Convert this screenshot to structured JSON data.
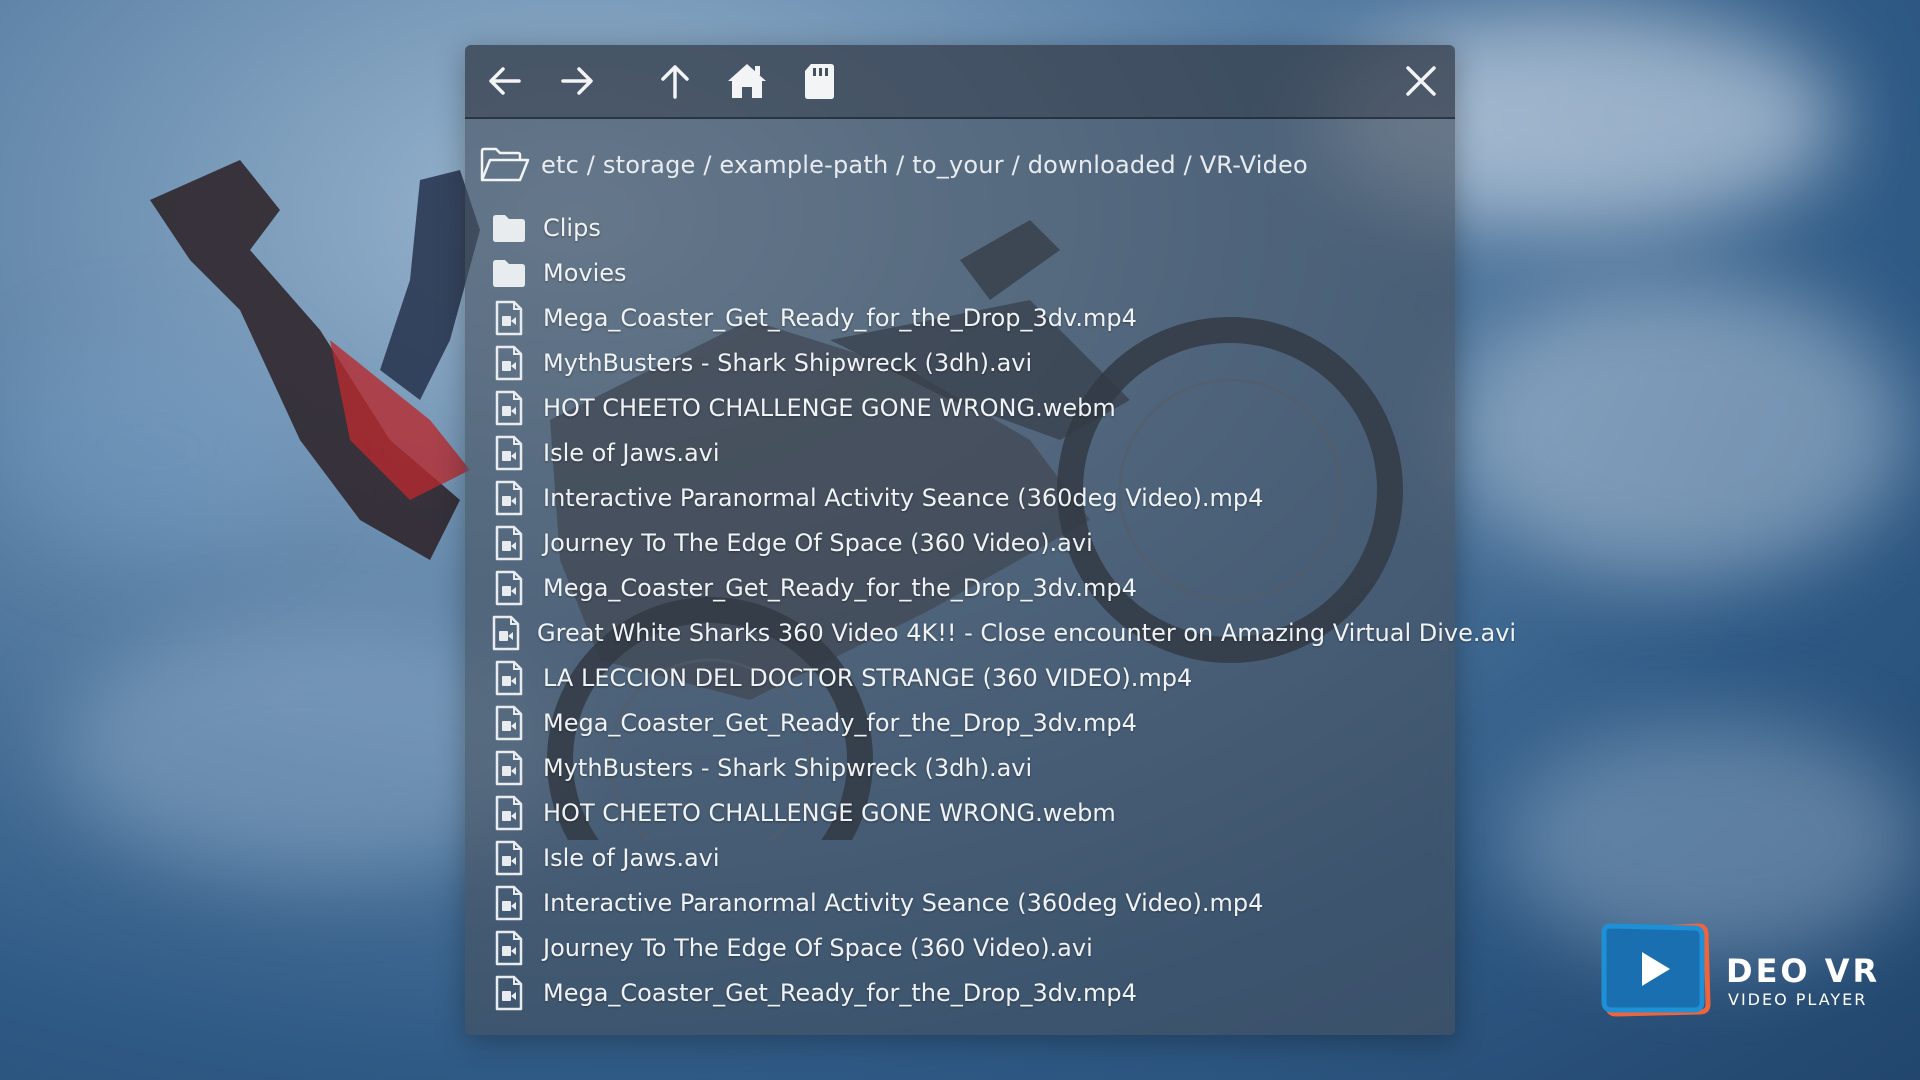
{
  "toolbar": {
    "back_icon": "arrow-left-icon",
    "forward_icon": "arrow-right-icon",
    "up_icon": "arrow-up-icon",
    "home_icon": "home-icon",
    "sd_icon": "sd-card-icon",
    "close_icon": "close-icon"
  },
  "path": "etc / storage / example-path / to_your / downloaded / VR-Video",
  "items": [
    {
      "type": "folder",
      "name": "Clips"
    },
    {
      "type": "folder",
      "name": "Movies"
    },
    {
      "type": "video",
      "name": "Mega_Coaster_Get_Ready_for_the_Drop_3dv.mp4"
    },
    {
      "type": "video",
      "name": "MythBusters - Shark Shipwreck (3dh).avi"
    },
    {
      "type": "video",
      "name": "HOT CHEETO CHALLENGE GONE WRONG.webm"
    },
    {
      "type": "video",
      "name": "Isle of Jaws.avi"
    },
    {
      "type": "video",
      "name": "Interactive Paranormal Activity Seance (360deg Video).mp4"
    },
    {
      "type": "video",
      "name": "Journey To The Edge Of Space (360 Video).avi"
    },
    {
      "type": "video",
      "name": "Mega_Coaster_Get_Ready_for_the_Drop_3dv.mp4"
    },
    {
      "type": "video",
      "name": "Great White Sharks 360 Video 4K!! - Close encounter on Amazing Virtual Dive.avi"
    },
    {
      "type": "video",
      "name": "LA LECCION DEL DOCTOR STRANGE (360 VIDEO).mp4"
    },
    {
      "type": "video",
      "name": "Mega_Coaster_Get_Ready_for_the_Drop_3dv.mp4"
    },
    {
      "type": "video",
      "name": "MythBusters - Shark Shipwreck (3dh).avi"
    },
    {
      "type": "video",
      "name": "HOT CHEETO CHALLENGE GONE WRONG.webm"
    },
    {
      "type": "video",
      "name": "Isle of Jaws.avi"
    },
    {
      "type": "video",
      "name": "Interactive Paranormal Activity Seance (360deg Video).mp4"
    },
    {
      "type": "video",
      "name": "Journey To The Edge Of Space (360 Video).avi"
    },
    {
      "type": "video",
      "name": "Mega_Coaster_Get_Ready_for_the_Drop_3dv.mp4"
    }
  ],
  "logo": {
    "title": "DEO VR",
    "subtitle": "VIDEO PLAYER",
    "colors": {
      "blue": "#1e90d6",
      "orange": "#f0643c"
    }
  },
  "colors": {
    "panel": "#46505f",
    "icon": "#f2f4f6",
    "text": "#f0f3f6"
  }
}
